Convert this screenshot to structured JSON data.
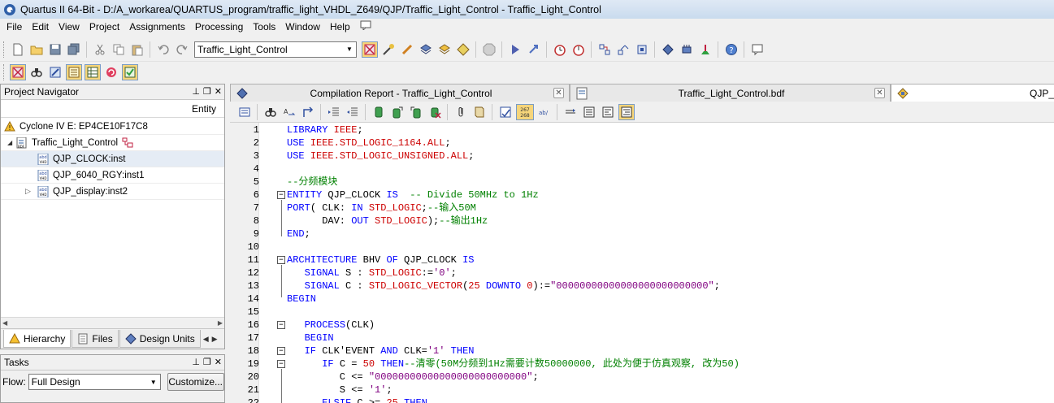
{
  "window": {
    "title": "Quartus II 64-Bit - D:/A_workarea/QUARTUS_program/traffic_light_VHDL_Z649/QJP/Traffic_Light_Control - Traffic_Light_Control"
  },
  "menu": [
    "File",
    "Edit",
    "View",
    "Project",
    "Assignments",
    "Processing",
    "Tools",
    "Window",
    "Help"
  ],
  "toolbar": {
    "entity_combo": "Traffic_Light_Control"
  },
  "navigator": {
    "title": "Project Navigator",
    "column_entity": "Entity",
    "device": "Cyclone IV E: EP4CE10F17C8",
    "top": "Traffic_Light_Control",
    "instances": [
      "QJP_CLOCK:inst",
      "QJP_6040_RGY:inst1",
      "QJP_display:inst2"
    ],
    "tabs": [
      "Hierarchy",
      "Files",
      "Design Units"
    ]
  },
  "tasks": {
    "title": "Tasks",
    "flow_label": "Flow:",
    "flow_value": "Full Design",
    "customize_label": "Customize..."
  },
  "doc_tabs": [
    "Compilation Report - Traffic_Light_Control",
    "Traffic_Light_Control.bdf",
    "QJP_"
  ],
  "code": [
    {
      "n": "1",
      "tokens": [
        [
          "kw",
          "LIBRARY"
        ],
        [
          "ind",
          " "
        ],
        [
          "ty",
          "IEEE"
        ],
        [
          "ind",
          ";"
        ]
      ]
    },
    {
      "n": "2",
      "tokens": [
        [
          "kw",
          "USE"
        ],
        [
          "ind",
          " "
        ],
        [
          "ty",
          "IEEE.STD_LOGIC_1164.ALL"
        ],
        [
          "ind",
          ";"
        ]
      ]
    },
    {
      "n": "3",
      "tokens": [
        [
          "kw",
          "USE"
        ],
        [
          "ind",
          " "
        ],
        [
          "ty",
          "IEEE.STD_LOGIC_UNSIGNED.ALL"
        ],
        [
          "ind",
          ";"
        ]
      ]
    },
    {
      "n": "4",
      "tokens": []
    },
    {
      "n": "5",
      "tokens": [
        [
          "cm",
          "--分频模块"
        ]
      ]
    },
    {
      "n": "6",
      "tokens": [
        [
          "kw",
          "ENTITY"
        ],
        [
          "ind",
          " QJP_CLOCK "
        ],
        [
          "kw",
          "IS"
        ],
        [
          "ind",
          "  "
        ],
        [
          "cm",
          "-- Divide 50MHz to 1Hz"
        ]
      ]
    },
    {
      "n": "7",
      "tokens": [
        [
          "kw",
          "PORT"
        ],
        [
          "ind",
          "( CLK: "
        ],
        [
          "kw",
          "IN"
        ],
        [
          "ind",
          " "
        ],
        [
          "ty",
          "STD_LOGIC"
        ],
        [
          "ind",
          ";"
        ],
        [
          "cm",
          "--输入50M"
        ]
      ]
    },
    {
      "n": "8",
      "tokens": [
        [
          "ind",
          "      DAV: "
        ],
        [
          "kw",
          "OUT"
        ],
        [
          "ind",
          " "
        ],
        [
          "ty",
          "STD_LOGIC"
        ],
        [
          "ind",
          ");"
        ],
        [
          "cm",
          "--输出1Hz"
        ]
      ]
    },
    {
      "n": "9",
      "tokens": [
        [
          "kw",
          "END"
        ],
        [
          "ind",
          ";"
        ]
      ]
    },
    {
      "n": "10",
      "tokens": []
    },
    {
      "n": "11",
      "tokens": [
        [
          "kw",
          "ARCHITECTURE"
        ],
        [
          "ind",
          " BHV "
        ],
        [
          "kw",
          "OF"
        ],
        [
          "ind",
          " QJP_CLOCK "
        ],
        [
          "kw",
          "IS"
        ]
      ]
    },
    {
      "n": "12",
      "tokens": [
        [
          "ind",
          "   "
        ],
        [
          "kw",
          "SIGNAL"
        ],
        [
          "ind",
          " S : "
        ],
        [
          "ty",
          "STD_LOGIC"
        ],
        [
          "ind",
          ":="
        ],
        [
          "st",
          "'0'"
        ],
        [
          "ind",
          ";"
        ]
      ]
    },
    {
      "n": "13",
      "tokens": [
        [
          "ind",
          "   "
        ],
        [
          "kw",
          "SIGNAL"
        ],
        [
          "ind",
          " C : "
        ],
        [
          "ty",
          "STD_LOGIC_VECTOR"
        ],
        [
          "ind",
          "("
        ],
        [
          "nm",
          "25"
        ],
        [
          "ind",
          " "
        ],
        [
          "kw",
          "DOWNTO"
        ],
        [
          "ind",
          " "
        ],
        [
          "nm",
          "0"
        ],
        [
          "ind",
          "):="
        ],
        [
          "st",
          "\"00000000000000000000000000\""
        ],
        [
          "ind",
          ";"
        ]
      ]
    },
    {
      "n": "14",
      "tokens": [
        [
          "kw",
          "BEGIN"
        ]
      ]
    },
    {
      "n": "15",
      "tokens": []
    },
    {
      "n": "16",
      "tokens": [
        [
          "ind",
          "   "
        ],
        [
          "kw",
          "PROCESS"
        ],
        [
          "ind",
          "(CLK)"
        ]
      ]
    },
    {
      "n": "17",
      "tokens": [
        [
          "ind",
          "   "
        ],
        [
          "kw",
          "BEGIN"
        ]
      ]
    },
    {
      "n": "18",
      "tokens": [
        [
          "ind",
          "   "
        ],
        [
          "kw",
          "IF"
        ],
        [
          "ind",
          " CLK'EVENT "
        ],
        [
          "kw",
          "AND"
        ],
        [
          "ind",
          " CLK="
        ],
        [
          "st",
          "'1'"
        ],
        [
          "ind",
          " "
        ],
        [
          "kw",
          "THEN"
        ]
      ]
    },
    {
      "n": "19",
      "tokens": [
        [
          "ind",
          "      "
        ],
        [
          "kw",
          "IF"
        ],
        [
          "ind",
          " C = "
        ],
        [
          "nm",
          "50"
        ],
        [
          "ind",
          " "
        ],
        [
          "kw",
          "THEN"
        ],
        [
          "cm",
          "--清零(50M分频到1Hz需要计数50000000, 此处为便于仿真观察, 改为50)"
        ]
      ]
    },
    {
      "n": "20",
      "tokens": [
        [
          "ind",
          "         C <= "
        ],
        [
          "st",
          "\"00000000000000000000000000\""
        ],
        [
          "ind",
          ";"
        ]
      ]
    },
    {
      "n": "21",
      "tokens": [
        [
          "ind",
          "         S <= "
        ],
        [
          "st",
          "'1'"
        ],
        [
          "ind",
          ";"
        ]
      ]
    },
    {
      "n": "22",
      "tokens": [
        [
          "ind",
          "      "
        ],
        [
          "kw",
          "ELSIF"
        ],
        [
          "ind",
          " C >= "
        ],
        [
          "nm",
          "25"
        ],
        [
          "ind",
          " "
        ],
        [
          "kw",
          "THEN"
        ]
      ]
    }
  ]
}
